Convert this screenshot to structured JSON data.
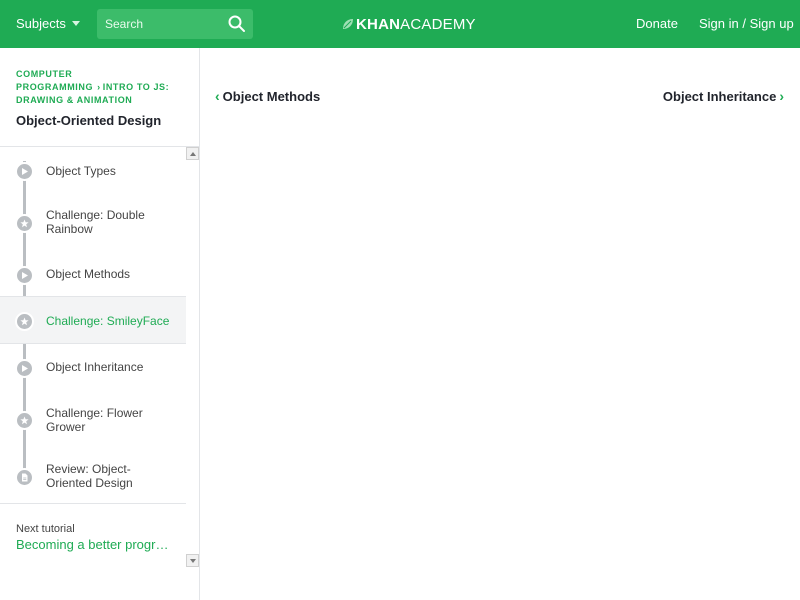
{
  "header": {
    "subjects_label": "Subjects",
    "search_placeholder": "Search",
    "logo_khan": "KHAN",
    "logo_academy": "ACADEMY",
    "donate_label": "Donate",
    "signin_label": "Sign in / Sign up",
    "brand_color": "#1fab54"
  },
  "sidebar": {
    "breadcrumb": {
      "part1": "COMPUTER PROGRAMMING",
      "part2": "INTRO TO JS: DRAWING & ANIMATION"
    },
    "tutorial_title": "Object-Oriented Design",
    "items": [
      {
        "label": "Object Types",
        "icon": "play-icon",
        "active": false
      },
      {
        "label": "Challenge: Double Rainbow",
        "icon": "star-icon",
        "active": false
      },
      {
        "label": "Object Methods",
        "icon": "play-icon",
        "active": false
      },
      {
        "label": "Challenge: SmileyFace",
        "icon": "star-icon",
        "active": true
      },
      {
        "label": "Object Inheritance",
        "icon": "play-icon",
        "active": false
      },
      {
        "label": "Challenge: Flower Grower",
        "icon": "star-icon",
        "active": false
      },
      {
        "label": "Review: Object-Oriented Design",
        "icon": "document-icon",
        "active": false
      }
    ],
    "next_tutorial_label": "Next tutorial",
    "next_tutorial_link": "Becoming a better programmer"
  },
  "main": {
    "prev_link": "Object Methods",
    "next_link": "Object Inheritance"
  }
}
